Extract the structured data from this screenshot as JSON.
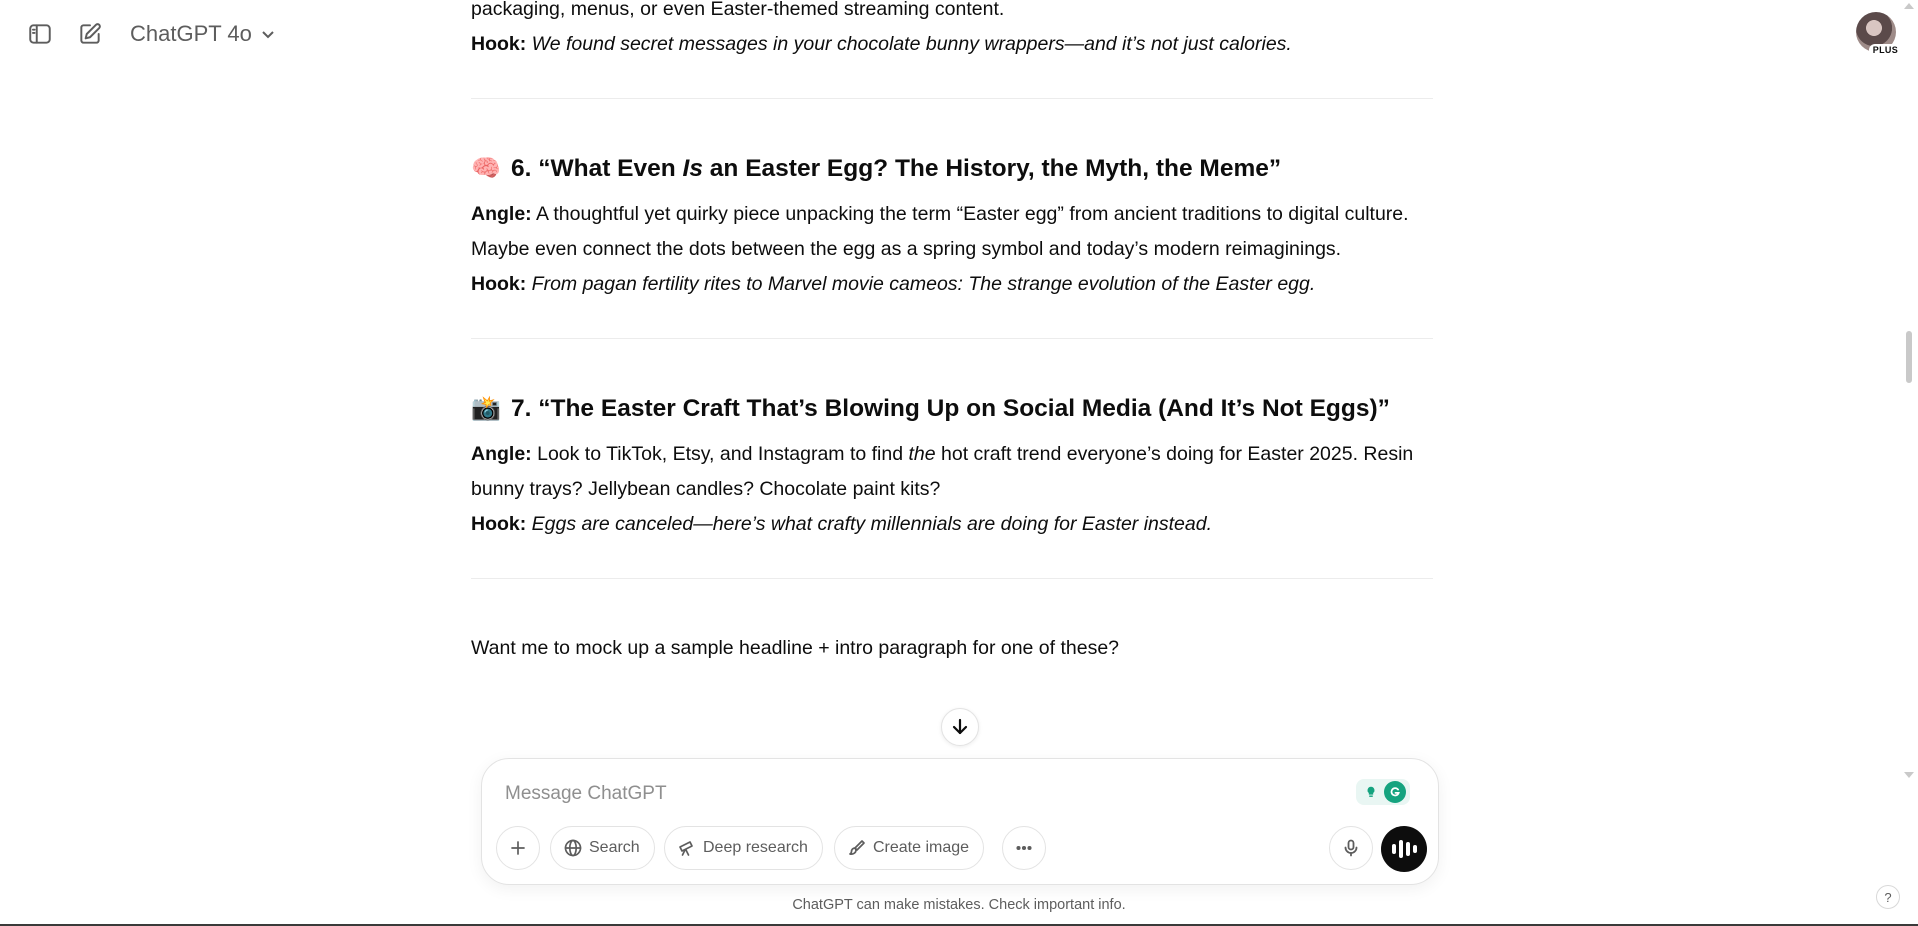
{
  "header": {
    "model_name": "ChatGPT 4o",
    "plan_badge": "PLUS"
  },
  "conversation": {
    "prev_tail_line": "packaging, menus, or even Easter-themed streaming content.",
    "prev_hook_label": "Hook:",
    "prev_hook_text": "We found secret messages in your chocolate bunny wrappers—and it’s not just calories.",
    "sections": [
      {
        "emoji": "🧠",
        "title_prefix": "6. “What Even ",
        "title_italic": "Is",
        "title_suffix": " an Easter Egg? The History, the Myth, the Meme”",
        "angle_label": "Angle:",
        "angle_text": "A thoughtful yet quirky piece unpacking the term “Easter egg” from ancient traditions to digital culture. Maybe even connect the dots between the egg as a spring symbol and today’s modern reimaginings.",
        "hook_label": "Hook:",
        "hook_text": "From pagan fertility rites to Marvel movie cameos: The strange evolution of the Easter egg."
      },
      {
        "emoji": "📸",
        "title_text": "7. “The Easter Craft That’s Blowing Up on Social Media (And It’s Not Eggs)”",
        "angle_label": "Angle:",
        "angle_pre": "Look to TikTok, Etsy, and Instagram to find ",
        "angle_italic": "the",
        "angle_post": " hot craft trend everyone’s doing for Easter 2025. Resin bunny trays? Jellybean candles? Chocolate paint kits?",
        "hook_label": "Hook:",
        "hook_text": "Eggs are canceled—here’s what crafty millennials are doing for Easter instead."
      }
    ],
    "closing_line": "Want me to mock up a sample headline + intro paragraph for one of these?"
  },
  "composer": {
    "placeholder": "Message ChatGPT",
    "tools": {
      "search": "Search",
      "deep_research": "Deep research",
      "create_image": "Create image"
    }
  },
  "footer": {
    "disclaimer": "ChatGPT can make mistakes. Check important info.",
    "help": "?"
  },
  "icons": {
    "sidebar_toggle": "sidebar-icon",
    "new_chat": "compose-icon",
    "model_dropdown": "chevron-down-icon",
    "scroll_down": "arrow-down-icon",
    "attach": "plus-icon",
    "search": "globe-icon",
    "deep_research": "telescope-icon",
    "create_image": "paintbrush-icon",
    "more": "ellipsis-icon",
    "mic": "microphone-icon",
    "voice": "voice-mode-icon",
    "grammarly": "grammarly-icon"
  },
  "colors": {
    "text": "#0d0d0d",
    "muted": "#5d5d5d",
    "grammarly_green": "#15a37f"
  }
}
